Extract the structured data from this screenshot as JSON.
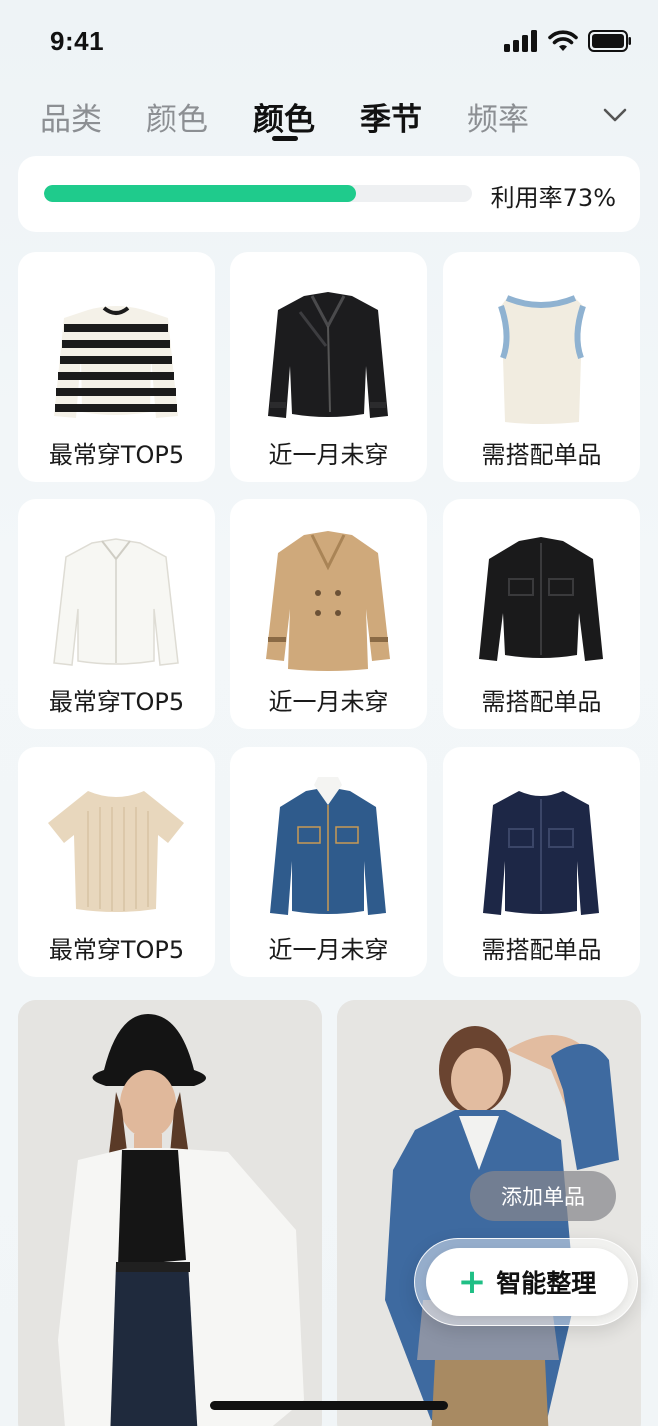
{
  "status": {
    "time": "9:41"
  },
  "tabs": [
    {
      "label": "品类"
    },
    {
      "label": "颜色"
    },
    {
      "label": "颜色",
      "active": true
    },
    {
      "label": "季节"
    },
    {
      "label": "频率"
    }
  ],
  "utilization": {
    "label": "利用率73%",
    "progress": 0.73,
    "color": "#1fcb8c"
  },
  "items": [
    {
      "label": "最常穿TOP5",
      "icon": "striped-sweater"
    },
    {
      "label": "近一月未穿",
      "icon": "leather-jacket"
    },
    {
      "label": "需搭配单品",
      "icon": "knit-vest"
    },
    {
      "label": "最常穿TOP5",
      "icon": "white-shirt"
    },
    {
      "label": "近一月未穿",
      "icon": "trench-coat"
    },
    {
      "label": "需搭配单品",
      "icon": "black-jacket"
    },
    {
      "label": "最常穿TOP5",
      "icon": "knit-tee"
    },
    {
      "label": "近一月未穿",
      "icon": "denim-jacket"
    },
    {
      "label": "需搭配单品",
      "icon": "navy-jacket"
    }
  ],
  "outfits": [
    {
      "icon": "model-bucket-hat-outfit"
    },
    {
      "icon": "model-denim-jacket-outfit"
    }
  ],
  "actions": {
    "add_item": "添加单品",
    "smart_organize": "智能整理",
    "accent_color": "#1fbf85"
  }
}
